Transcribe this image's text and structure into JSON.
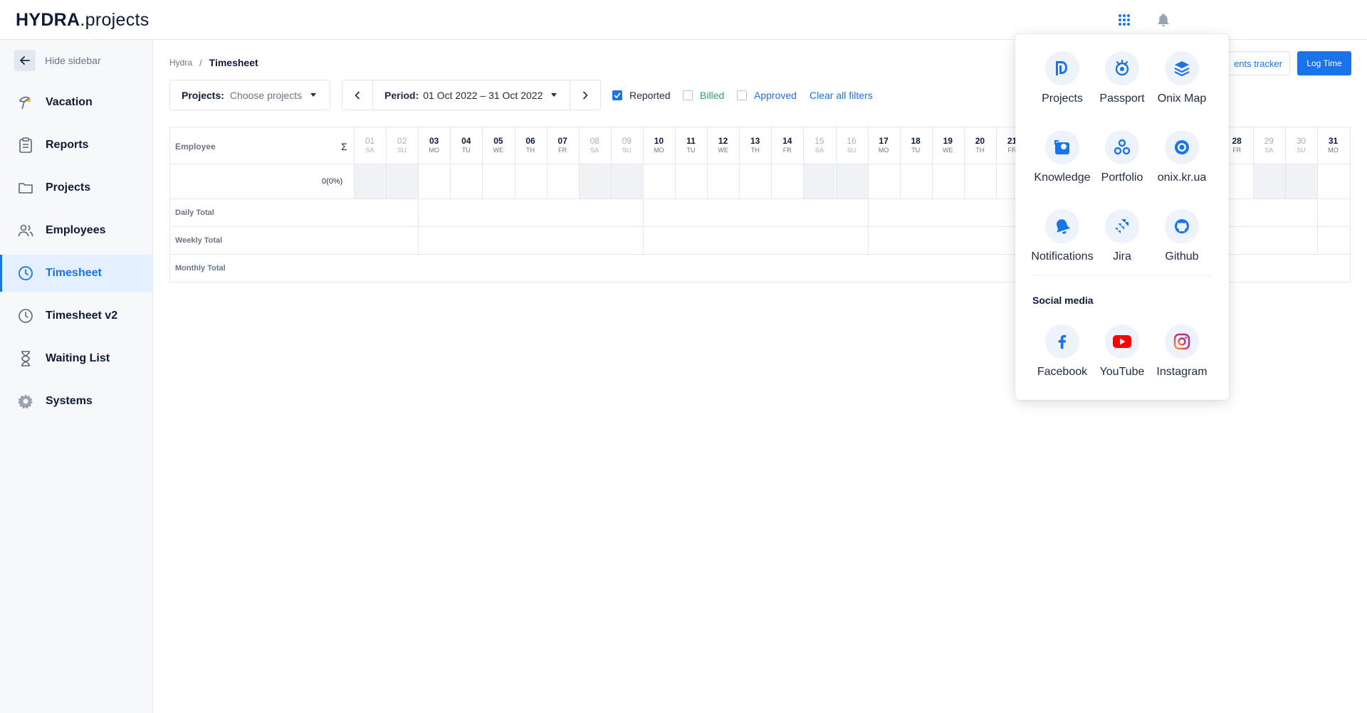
{
  "header": {
    "logo_bold": "HYDRA",
    "logo_light": ".projects",
    "apps_icon": "grid-icon",
    "notifications_icon": "bell-icon"
  },
  "sidebar": {
    "hide_label": "Hide sidebar",
    "items": [
      {
        "label": "Vacation",
        "icon": "umbrella-icon",
        "active": false
      },
      {
        "label": "Reports",
        "icon": "clipboard-icon",
        "active": false
      },
      {
        "label": "Projects",
        "icon": "folder-icon",
        "active": false
      },
      {
        "label": "Employees",
        "icon": "users-icon",
        "active": false
      },
      {
        "label": "Timesheet",
        "icon": "clock-icon",
        "active": true
      },
      {
        "label": "Timesheet v2",
        "icon": "clock-icon",
        "active": false
      },
      {
        "label": "Waiting List",
        "icon": "hourglass-icon",
        "active": false
      },
      {
        "label": "Systems",
        "icon": "gear-icon",
        "active": false
      }
    ]
  },
  "breadcrumb": {
    "root": "Hydra",
    "separator": "/",
    "current": "Timesheet"
  },
  "filters": {
    "projects_key": "Projects:",
    "projects_placeholder": "Choose projects",
    "period_key": "Period:",
    "period_value": "01 Oct 2022 – 31 Oct 2022",
    "reported": {
      "label": "Reported",
      "checked": true
    },
    "billed": {
      "label": "Billed",
      "checked": false
    },
    "approved": {
      "label": "Approved",
      "checked": false
    },
    "clear_all": "Clear all filters"
  },
  "actions": {
    "tracker_label": "ents tracker",
    "log_time": "Log Time"
  },
  "table": {
    "employee_header": "Employee",
    "sigma": "Σ",
    "total_value": "0(0%)",
    "row_labels": [
      "Daily Total",
      "Weekly Total",
      "Monthly Total"
    ],
    "days": [
      {
        "num": "01",
        "dow": "SA",
        "weekend": true
      },
      {
        "num": "02",
        "dow": "SU",
        "weekend": true
      },
      {
        "num": "03",
        "dow": "MO",
        "weekend": false
      },
      {
        "num": "04",
        "dow": "TU",
        "weekend": false
      },
      {
        "num": "05",
        "dow": "WE",
        "weekend": false
      },
      {
        "num": "06",
        "dow": "TH",
        "weekend": false
      },
      {
        "num": "07",
        "dow": "FR",
        "weekend": false
      },
      {
        "num": "08",
        "dow": "SA",
        "weekend": true
      },
      {
        "num": "09",
        "dow": "SU",
        "weekend": true
      },
      {
        "num": "10",
        "dow": "MO",
        "weekend": false
      },
      {
        "num": "11",
        "dow": "TU",
        "weekend": false
      },
      {
        "num": "12",
        "dow": "WE",
        "weekend": false
      },
      {
        "num": "13",
        "dow": "TH",
        "weekend": false
      },
      {
        "num": "14",
        "dow": "FR",
        "weekend": false
      },
      {
        "num": "15",
        "dow": "SA",
        "weekend": true
      },
      {
        "num": "16",
        "dow": "SU",
        "weekend": true
      },
      {
        "num": "17",
        "dow": "MO",
        "weekend": false
      },
      {
        "num": "18",
        "dow": "TU",
        "weekend": false
      },
      {
        "num": "19",
        "dow": "WE",
        "weekend": false
      },
      {
        "num": "20",
        "dow": "TH",
        "weekend": false
      },
      {
        "num": "21",
        "dow": "FR",
        "weekend": false
      },
      {
        "num": "28",
        "dow": "FR",
        "weekend": false
      },
      {
        "num": "29",
        "dow": "SA",
        "weekend": true
      },
      {
        "num": "30",
        "dow": "SU",
        "weekend": true
      },
      {
        "num": "31",
        "dow": "MO",
        "weekend": false
      }
    ]
  },
  "apps_popup": {
    "apps": [
      {
        "label": "Projects",
        "icon": "projects-logo-icon"
      },
      {
        "label": "Passport",
        "icon": "passport-icon"
      },
      {
        "label": "Onix Map",
        "icon": "layers-icon"
      },
      {
        "label": "Knowledge",
        "icon": "knowledge-icon"
      },
      {
        "label": "Portfolio",
        "icon": "portfolio-icon"
      },
      {
        "label": "onix.kr.ua",
        "icon": "target-icon"
      },
      {
        "label": "Notifications",
        "icon": "bell-icon"
      },
      {
        "label": "Jira",
        "icon": "jira-icon"
      },
      {
        "label": "Github",
        "icon": "github-icon"
      }
    ],
    "social_title": "Social media",
    "social": [
      {
        "label": "Facebook",
        "icon": "facebook-icon"
      },
      {
        "label": "YouTube",
        "icon": "youtube-icon"
      },
      {
        "label": "Instagram",
        "icon": "instagram-icon"
      }
    ]
  },
  "colors": {
    "accent": "#1a73e8",
    "billed": "#34a36b",
    "approved": "#1a73e8"
  }
}
